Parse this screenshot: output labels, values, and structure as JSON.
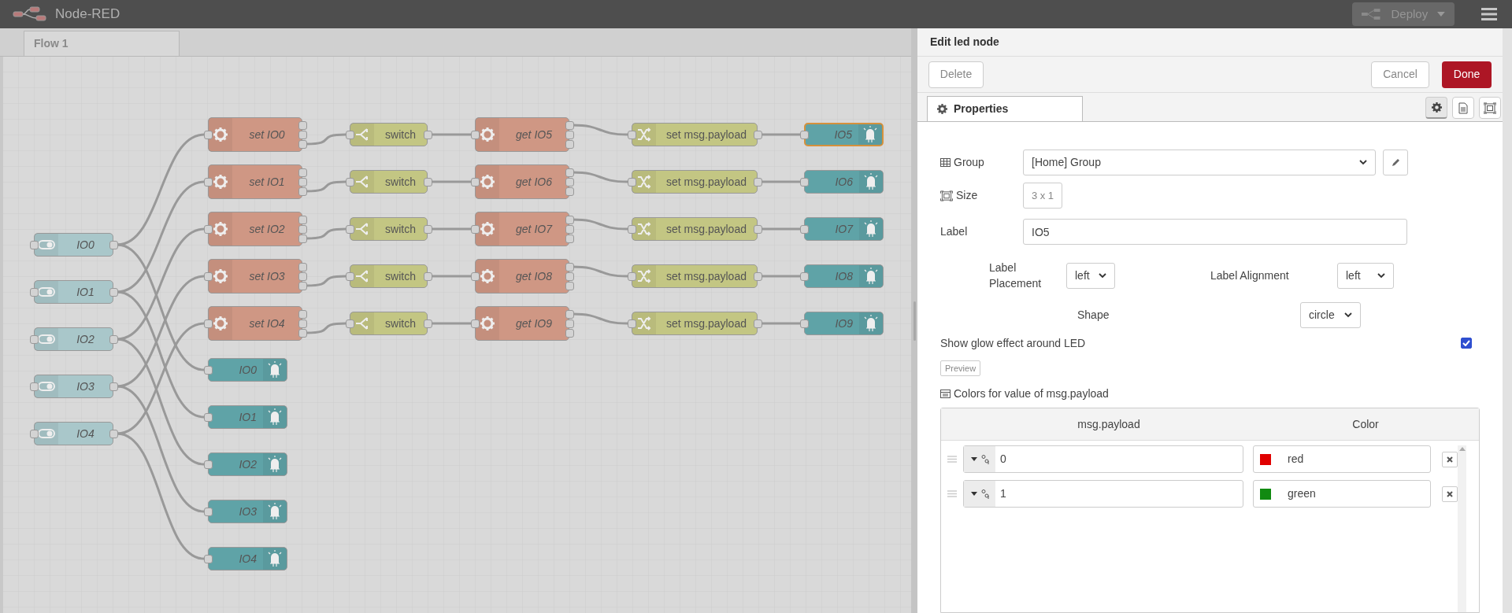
{
  "header": {
    "title": "Node-RED",
    "deploy": "Deploy"
  },
  "workspace_tabs": [
    {
      "label": "Flow 1",
      "selected": true
    }
  ],
  "flow": {
    "inputs": [
      "IO0",
      "IO1",
      "IO2",
      "IO3",
      "IO4"
    ],
    "rows": [
      {
        "set": "set IO0",
        "switch": "switch",
        "get": "get IO5",
        "change": "set msg.payload",
        "led": "IO5",
        "selected": true
      },
      {
        "set": "set IO1",
        "switch": "switch",
        "get": "get IO6",
        "change": "set msg.payload",
        "led": "IO6",
        "selected": false
      },
      {
        "set": "set IO2",
        "switch": "switch",
        "get": "get IO7",
        "change": "set msg.payload",
        "led": "IO7",
        "selected": false
      },
      {
        "set": "set IO3",
        "switch": "switch",
        "get": "get IO8",
        "change": "set msg.payload",
        "led": "IO8",
        "selected": false
      },
      {
        "set": "set IO4",
        "switch": "switch",
        "get": "get IO9",
        "change": "set msg.payload",
        "led": "IO9",
        "selected": false
      }
    ],
    "outputs": [
      "IO0",
      "IO1",
      "IO2",
      "IO3",
      "IO4"
    ]
  },
  "editor": {
    "title": "Edit led node",
    "delete": "Delete",
    "cancel": "Cancel",
    "done": "Done",
    "tabs": [
      {
        "label": "Properties",
        "selected": true
      }
    ],
    "side_tabs": [
      {
        "kind": "properties",
        "selected": true
      },
      {
        "kind": "description",
        "selected": false
      },
      {
        "kind": "appearance",
        "selected": false
      }
    ],
    "group": {
      "label": "Group",
      "value": "[Home] Group"
    },
    "size": {
      "label": "Size",
      "value": "3 x 1"
    },
    "label": {
      "label": "Label",
      "value": "IO5"
    },
    "label_placement": {
      "label": "Label Placement",
      "value": "left"
    },
    "label_alignment": {
      "label": "Label Alignment",
      "value": "left"
    },
    "shape": {
      "label": "Shape",
      "value": "circle"
    },
    "glow": {
      "label": "Show glow effect around LED",
      "checked": true
    },
    "preview": "Preview",
    "colors": {
      "title": "Colors for value of msg.payload",
      "columns": [
        "msg.payload",
        "Color"
      ],
      "rows": [
        {
          "value": "0",
          "color_name": "red",
          "color": "#e00000"
        },
        {
          "value": "1",
          "color_name": "green",
          "color": "#118a11"
        }
      ]
    }
  }
}
